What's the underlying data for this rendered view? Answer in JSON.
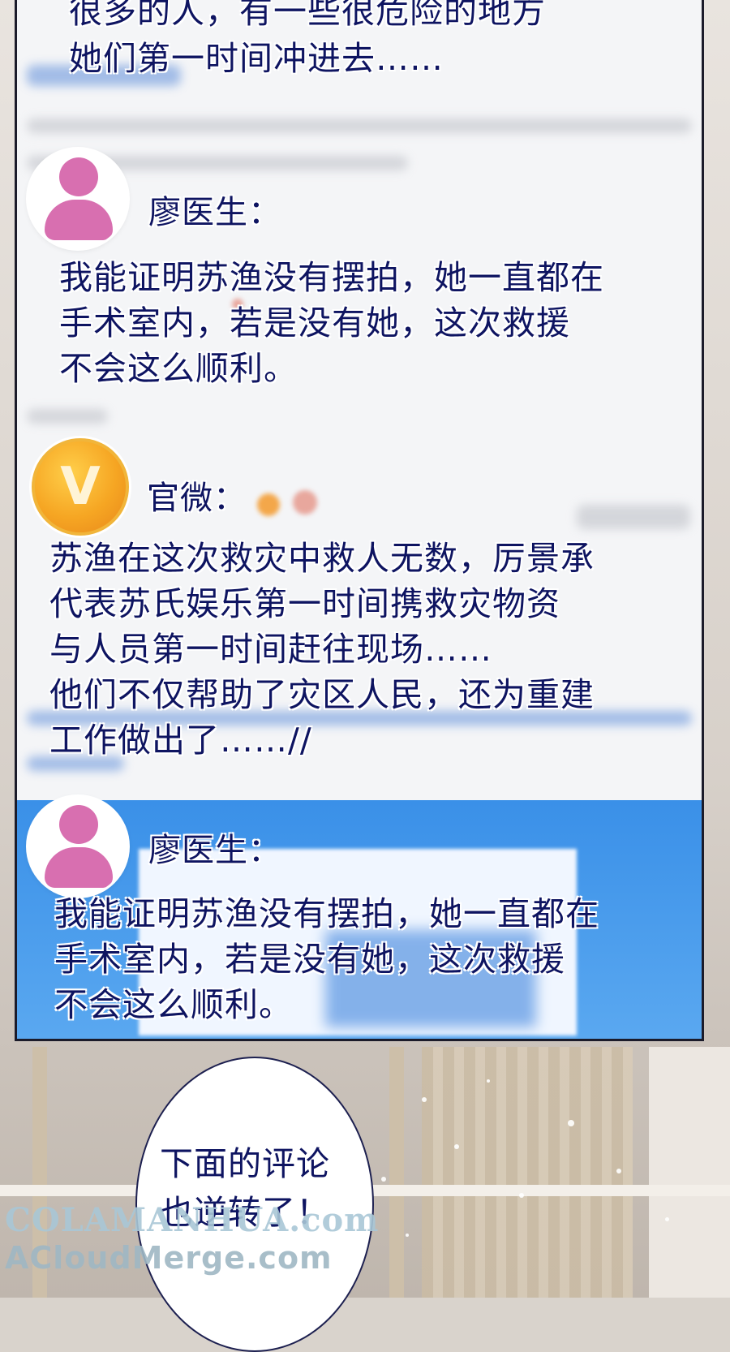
{
  "post1": {
    "line1": "很多的人，有一些很危险的地方",
    "line2": "她们第一时间冲进去……"
  },
  "comment1": {
    "name": "廖医生：",
    "lines": [
      "我能证明苏渔没有摆拍，她一直都在",
      "手术室内，若是没有她，这次救援",
      "不会这么顺利。"
    ]
  },
  "comment2": {
    "badge": "V",
    "name": "官微：",
    "lines": [
      "苏渔在这次救灾中救人无数，厉景承",
      "代表苏氏娱乐第一时间携救灾物资",
      "与人员第一时间赶往现场……",
      "他们不仅帮助了灾区人民，还为重建",
      "工作做出了……//"
    ]
  },
  "comment3": {
    "name": "廖医生：",
    "lines": [
      "我能证明苏渔没有摆拍，她一直都在",
      "手术室内，若是没有她，这次救援",
      "不会这么顺利。"
    ]
  },
  "speech_bubble": {
    "lines": [
      "下面的评论",
      "也逆转了！"
    ]
  },
  "watermark": {
    "line1": "COLAMANHUA.com",
    "line2": "ACloudMerge.com"
  },
  "colors": {
    "text": "#0e1461",
    "avatar": "#d86fb0",
    "badge": "#f6a623",
    "panel_blue": "#3a90e8"
  }
}
